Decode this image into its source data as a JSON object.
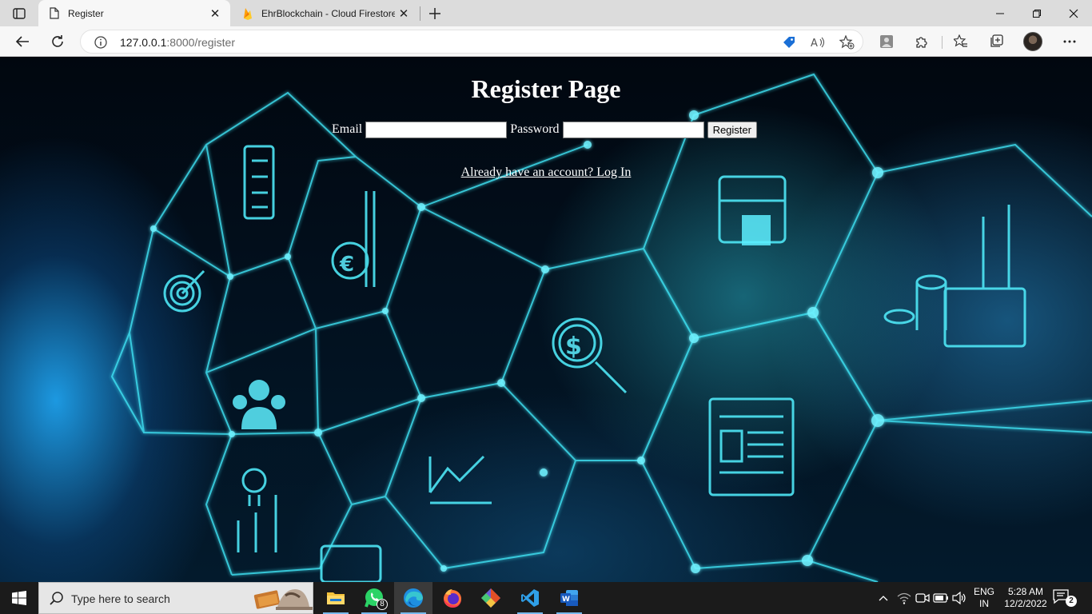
{
  "browser": {
    "tabs": [
      {
        "title": "Register",
        "icon": "document-icon",
        "active": true
      },
      {
        "title": "EhrBlockchain - Cloud Firestore -",
        "icon": "firebase-icon",
        "active": false
      }
    ],
    "address": {
      "host": "127.0.0.1",
      "path": ":8000/register"
    }
  },
  "page": {
    "title": "Register Page",
    "form": {
      "email_label": "Email",
      "email_value": "",
      "password_label": "Password",
      "password_value": "",
      "submit_label": "Register"
    },
    "login_link": "Already have an account? Log In"
  },
  "taskbar": {
    "search_placeholder": "Type here to search",
    "whatsapp_badge": "8",
    "language": [
      "ENG",
      "IN"
    ],
    "time": "5:28 AM",
    "date": "12/2/2022",
    "notification_count": "2"
  },
  "colors": {
    "accent": "#35d8ee",
    "link": "#ffffff",
    "taskbar": "#1b1b1b"
  }
}
